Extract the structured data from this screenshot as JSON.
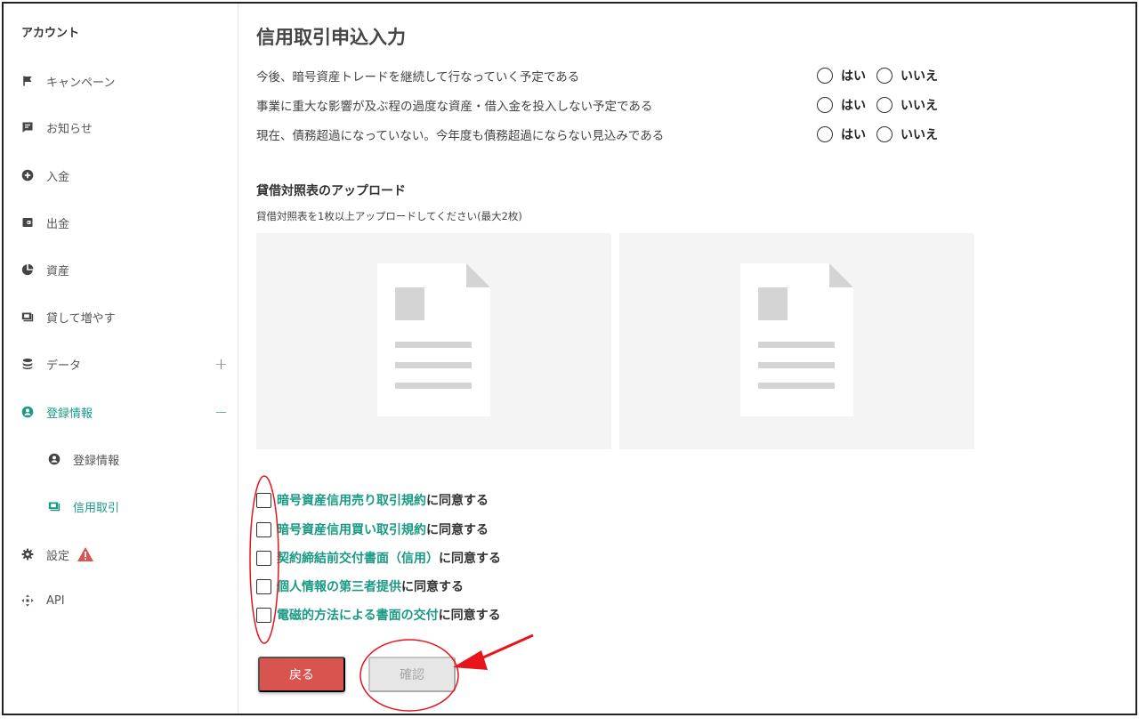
{
  "sidebar": {
    "title": "アカウント",
    "items": [
      {
        "label": "キャンペーン",
        "icon": "flag-icon"
      },
      {
        "label": "お知らせ",
        "icon": "message-icon"
      },
      {
        "label": "入金",
        "icon": "plus-circle-icon"
      },
      {
        "label": "出金",
        "icon": "wallet-icon"
      },
      {
        "label": "資産",
        "icon": "pie-chart-icon"
      },
      {
        "label": "貸して増やす",
        "icon": "money-icon"
      },
      {
        "label": "データ",
        "icon": "database-icon",
        "toggle": "+"
      },
      {
        "label": "登録情報",
        "icon": "user-circle-icon",
        "toggle": "−"
      },
      {
        "label": "登録情報",
        "icon": "user-circle-icon"
      },
      {
        "label": "信用取引",
        "icon": "money-icon"
      },
      {
        "label": "設定",
        "icon": "gear-icon",
        "badge": "warning-icon"
      },
      {
        "label": "API",
        "icon": "api-icon"
      }
    ]
  },
  "main": {
    "title": "信用取引申込入力",
    "questions": [
      {
        "text": "今後、暗号資産トレードを継続して行なっていく予定である",
        "yes": "はい",
        "no": "いいえ"
      },
      {
        "text": "事業に重大な影響が及ぶ程の過度な資産・借入金を投入しない予定である",
        "yes": "はい",
        "no": "いいえ"
      },
      {
        "text": "現在、債務超過になっていない。今年度も債務超過にならない見込みである",
        "yes": "はい",
        "no": "いいえ"
      }
    ],
    "upload": {
      "title": "貸借対照表のアップロード",
      "note": "貸借対照表を1枚以上アップロードしてください(最大2枚)"
    },
    "agreements": [
      {
        "link": "暗号資産信用売り取引規約",
        "suffix": "に同意する"
      },
      {
        "link": "暗号資産信用買い取引規約",
        "suffix": "に同意する"
      },
      {
        "link": "契約締結前交付書面（信用）",
        "suffix": "に同意する"
      },
      {
        "link": "個人情報の第三者提供",
        "suffix": "に同意する"
      },
      {
        "link": "電磁的方法による書面の交付",
        "suffix": "に同意する"
      }
    ],
    "buttons": {
      "back": "戻る",
      "confirm": "確認"
    }
  },
  "colors": {
    "accent": "#1a9a83",
    "danger": "#d9534f",
    "disabled": "#e6e6e6",
    "annotation": "#e8141b"
  }
}
